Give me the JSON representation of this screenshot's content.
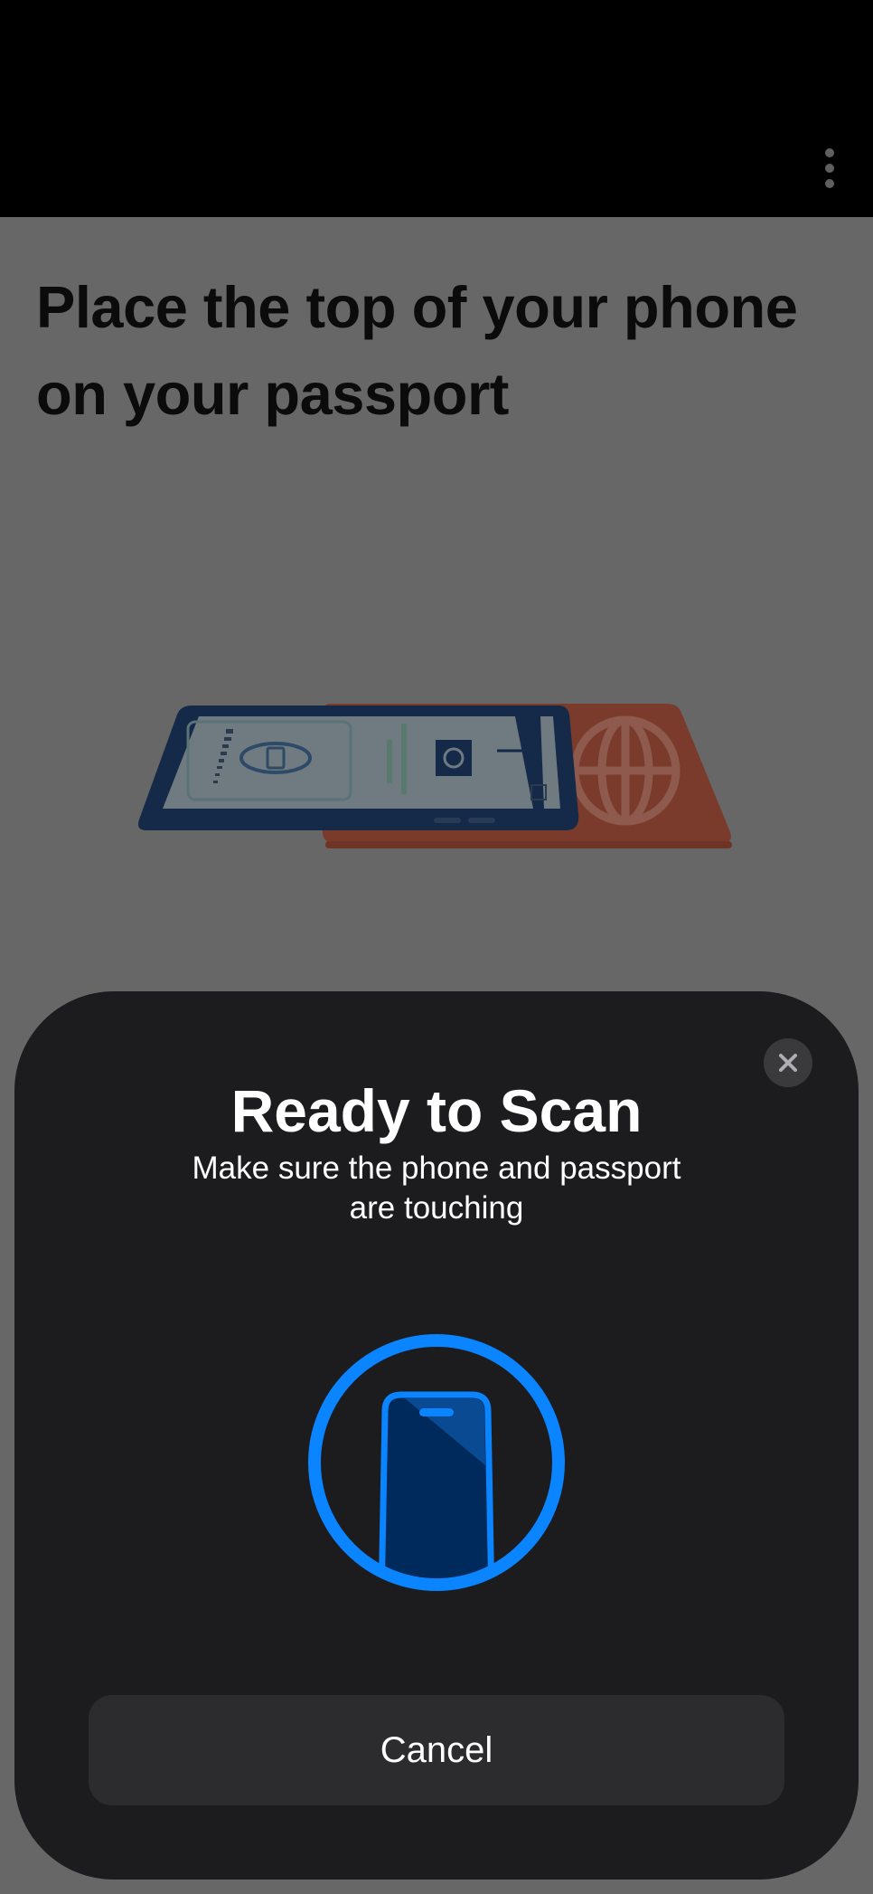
{
  "screen": {
    "heading": "Place the top of your phone on your passport"
  },
  "top_bar": {
    "menu_icon": "more-vertical-icon"
  },
  "illustration": {
    "icon": "phone-on-passport-illustration",
    "colors": {
      "phone_frame": "#152a49",
      "phone_screen": "#6f7b80",
      "passport": "#7a3b2c"
    }
  },
  "scan_sheet": {
    "title": "Ready to Scan",
    "subtitle": "Make sure the phone and passport are touching",
    "close_icon": "close-icon",
    "scan_icon": "phone-nfc-icon",
    "cancel_label": "Cancel",
    "accent_color": "#0a84ff"
  }
}
